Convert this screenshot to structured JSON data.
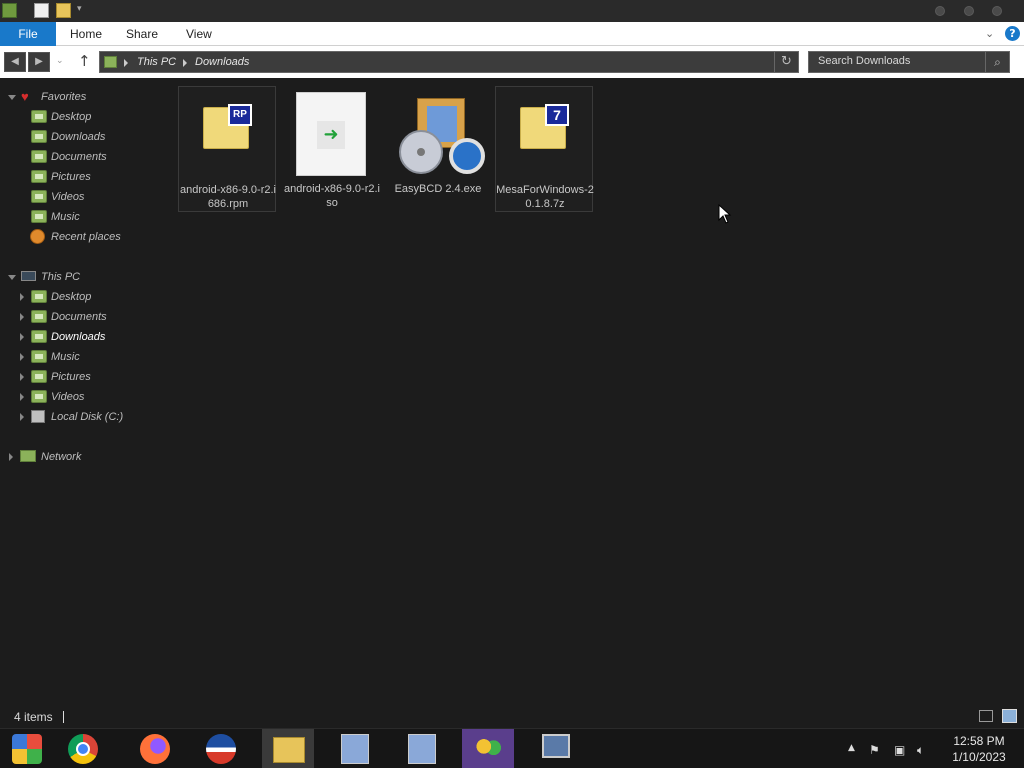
{
  "ribbon": {
    "tabs": [
      {
        "label": "File"
      },
      {
        "label": "Home"
      },
      {
        "label": "Share"
      },
      {
        "label": "View"
      }
    ]
  },
  "address": {
    "crumbs": [
      "This PC",
      "Downloads"
    ],
    "search_placeholder": "Search Downloads"
  },
  "sidebar": {
    "favorites": {
      "label": "Favorites",
      "items": [
        "Desktop",
        "Downloads",
        "Documents",
        "Pictures",
        "Videos",
        "Music",
        "Recent places"
      ]
    },
    "this_pc": {
      "label": "This PC",
      "items": [
        "Desktop",
        "Documents",
        "Downloads",
        "Music",
        "Pictures",
        "Videos",
        "Local Disk (C:)"
      ],
      "selected": "Downloads"
    },
    "network": {
      "label": "Network"
    }
  },
  "files": [
    {
      "name": "android-x86-9.0-r2.i686.rpm",
      "icon": "rpm-archive-icon",
      "selected": true
    },
    {
      "name": "android-x86-9.0-r2.iso",
      "icon": "iso-file-icon",
      "selected": false
    },
    {
      "name": "EasyBCD 2.4.exe",
      "icon": "installer-icon",
      "selected": false
    },
    {
      "name": "MesaForWindows-20.1.8.7z",
      "icon": "7z-archive-icon",
      "selected": true
    }
  ],
  "status": {
    "text": "4 items"
  },
  "clock": {
    "time": "12:58 PM",
    "date": "1/10/2023"
  },
  "colors": {
    "accent": "#1979ca",
    "background": "#1c1c1c",
    "folder": "#f0d97a"
  }
}
